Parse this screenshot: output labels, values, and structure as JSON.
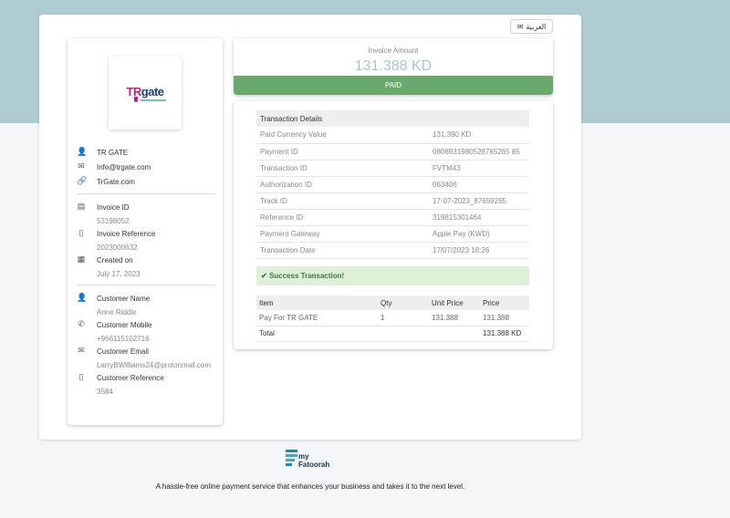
{
  "language_button": {
    "label": "العربية",
    "icon": "chat-bubble-icon"
  },
  "merchant": {
    "logo_text_tr": "TR",
    "logo_text_gate": "gate",
    "name": "TR GATE",
    "email": "Info@trgate.com",
    "website": "TrGate.com"
  },
  "invoice": {
    "id_label": "Invoice ID",
    "id_value": "53198052",
    "reference_label": "Invoice Reference",
    "reference_value": "2023000632",
    "created_label": "Created on",
    "created_value": "July 17, 2023"
  },
  "customer": {
    "name_label": "Customer Name",
    "name_value": "Anne Riddle",
    "mobile_label": "Customer Mobile",
    "mobile_value": "+966115102716",
    "email_label": "Customer Email",
    "email_value": "LarryBWilliams24@protonmail.com",
    "reference_label": "Customer Reference",
    "reference_value": "3584"
  },
  "amount": {
    "label": "Invoice Amount",
    "value": "131.388 KD",
    "status": "PAID",
    "status_color": "#6aa96d"
  },
  "transaction": {
    "header": "Transaction Details",
    "rows": [
      {
        "label": "Paid Currency Value",
        "value": "131.390 KD"
      },
      {
        "label": "Payment ID",
        "value": "0808931980528765265 85"
      },
      {
        "label": "Transaction ID",
        "value": "FVTM43"
      },
      {
        "label": "Authorization ID",
        "value": "063406"
      },
      {
        "label": "Track ID",
        "value": "17-07-2023_87659265"
      },
      {
        "label": "Reference ID",
        "value": "319815301464"
      },
      {
        "label": "Payment Gateway",
        "value": "Apple Pay (KWD)"
      },
      {
        "label": "Transaction Date",
        "value": "17/07/2023 18:26"
      }
    ]
  },
  "success_message": "Success Transaction!",
  "items": {
    "headers": [
      "Item",
      "Qty",
      "Unit Price",
      "Price"
    ],
    "rows": [
      [
        "Pay For TR GATE",
        "1",
        "131.388",
        "131.388"
      ]
    ],
    "total_label": "Total",
    "total_value": "131.388 KD"
  },
  "footer": {
    "brand_line1": "my",
    "brand_line2": "Fatoorah",
    "tagline": "A hassle-free online payment service that enhances your business and takes it to the next level."
  }
}
